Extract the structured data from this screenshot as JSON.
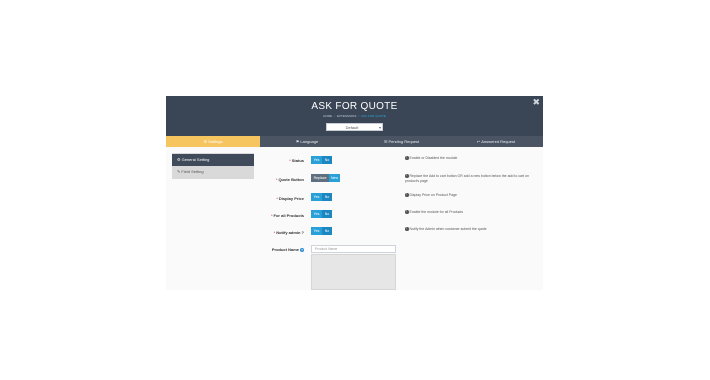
{
  "header": {
    "title": "ASK FOR QUOTE",
    "breadcrumb": [
      "HOME",
      "EXTENSIONS",
      "ASK FOR QUOTE"
    ],
    "store_select": "Default",
    "close_glyph": "✖"
  },
  "tabs": [
    {
      "label": "Settings",
      "icon": "gear-icon",
      "active": true
    },
    {
      "label": "Language",
      "icon": "flag-icon",
      "active": false
    },
    {
      "label": "Pending Request",
      "icon": "list-icon",
      "active": false
    },
    {
      "label": "Answered Request",
      "icon": "reply-icon",
      "active": false
    }
  ],
  "sidebar": {
    "items": [
      {
        "label": "General Setting",
        "icon": "gear-icon",
        "active": true
      },
      {
        "label": "Field Setting",
        "icon": "edit-icon",
        "active": false
      }
    ]
  },
  "form": {
    "rows": [
      {
        "label": "Status",
        "required": true,
        "toggle": [
          "Yes",
          "No"
        ],
        "desc": "Enable or Disabled the module"
      },
      {
        "label": "Quote Button",
        "required": true,
        "toggle": [
          "Replace",
          "New"
        ],
        "desc": "Replace the Add to cart button OR add a new button below the add to cart on product's page"
      },
      {
        "label": "Display Price",
        "required": true,
        "toggle": [
          "Yes",
          "No"
        ],
        "desc": "Display Price on Product Page"
      },
      {
        "label": "For all Products",
        "required": true,
        "toggle": [
          "Yes",
          "No"
        ],
        "desc": "Enable the module for all Products"
      },
      {
        "label": "Notify admin ?",
        "required": true,
        "toggle": [
          "Yes",
          "No"
        ],
        "desc": "Notify the Admin when customer submit the quote"
      }
    ],
    "product_name": {
      "label": "Product Name",
      "placeholder": "Product Name"
    }
  },
  "colors": {
    "header_bg": "#3a4556",
    "tab_active": "#f6c560",
    "toggle_blue": "#2aa0d8",
    "sidebar_active": "#3f4a5a"
  }
}
